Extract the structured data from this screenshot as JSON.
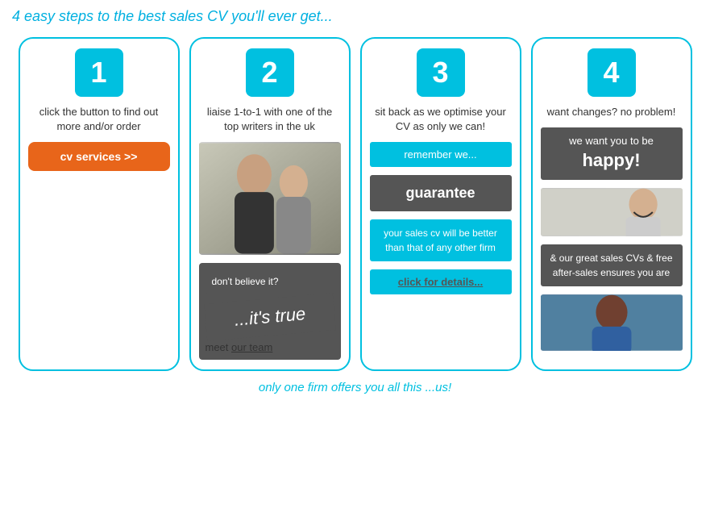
{
  "page": {
    "title": "4 easy steps to the best sales CV you'll ever get...",
    "footer": "only one firm offers you all this ...us!"
  },
  "card1": {
    "step": "1",
    "description": "click the button to find out more and/or order",
    "button_label": "cv services >>"
  },
  "card2": {
    "step": "2",
    "description": "liaise 1-to-1 with one of the top writers in the uk",
    "dont_believe": "don't believe it?",
    "its_true": "...it's true",
    "meet_team_prefix": "meet ",
    "meet_team_link": "our team"
  },
  "card3": {
    "step": "3",
    "description": "sit back as we optimise your CV as only we can!",
    "remember": "remember we...",
    "guarantee": "guarantee",
    "better": "your sales cv will be better than that of any other firm",
    "click": "click",
    "for_details": " for details..."
  },
  "card4": {
    "step": "4",
    "description": "want changes? no problem!",
    "we_want": "we want you to be",
    "happy": "happy!",
    "after_sales": "& our great sales CVs & free after-sales ensures you are"
  }
}
